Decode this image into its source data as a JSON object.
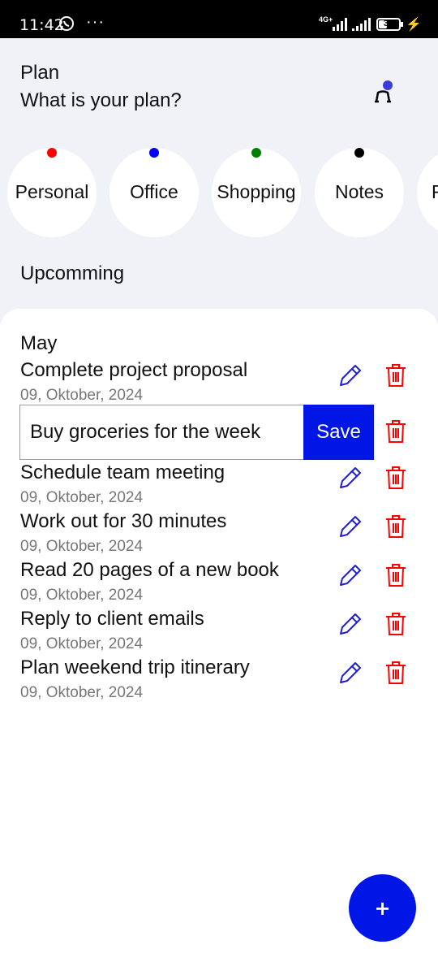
{
  "status_bar": {
    "time": "11:42",
    "network": "4G+",
    "battery": "38",
    "battery_level": 0.38,
    "icons": [
      "whatsapp-icon",
      "more-dots-icon",
      "signal-icon",
      "battery-icon",
      "charging-icon"
    ]
  },
  "header": {
    "title": "Plan",
    "subtitle": "What is your plan?",
    "profile_icon": "person-icon"
  },
  "categories": [
    {
      "label": "Personal",
      "color": "#ff0000"
    },
    {
      "label": "Office",
      "color": "#0000ff"
    },
    {
      "label": "Shopping",
      "color": "#008000"
    },
    {
      "label": "Notes",
      "color": "#000000"
    },
    {
      "label": "F",
      "color": "#000000"
    }
  ],
  "section_title": "Upcomming",
  "month": "May",
  "tasks": [
    {
      "title": "Complete project proposal",
      "date": "09, Oktober, 2024"
    },
    {
      "title": "Schedule team meeting",
      "date": "09, Oktober, 2024"
    },
    {
      "title": "Work out for 30 minutes",
      "date": "09, Oktober, 2024"
    },
    {
      "title": "Read 20 pages of a new book",
      "date": "09, Oktober, 2024"
    },
    {
      "title": "Reply to client emails",
      "date": "09, Oktober, 2024"
    },
    {
      "title": "Plan weekend trip itinerary",
      "date": "09, Oktober, 2024"
    }
  ],
  "editing": {
    "value": "Buy groceries for the week",
    "save_label": "Save"
  },
  "fab": {
    "label": "+"
  },
  "colors": {
    "accent": "#0016e6",
    "edit_icon": "#1f1fd0",
    "delete_icon": "#ff0000",
    "background": "#f1f2f8"
  }
}
